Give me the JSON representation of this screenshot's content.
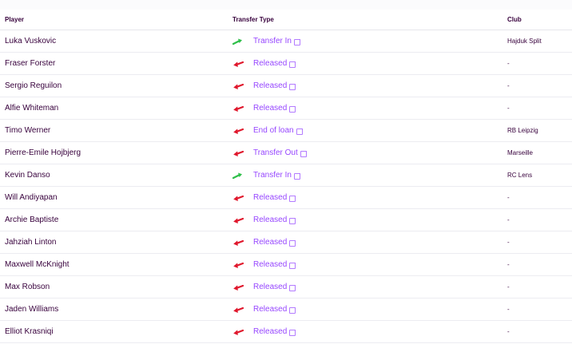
{
  "page": {
    "heading": ""
  },
  "table": {
    "headers": {
      "player": "Player",
      "transfer_type": "Transfer Type",
      "club": "Club"
    },
    "rows": [
      {
        "player": "Luka Vuskovic",
        "type": "Transfer In",
        "direction": "in",
        "club": "Hajduk Split"
      },
      {
        "player": "Fraser Forster",
        "type": "Released",
        "direction": "out",
        "club": "-"
      },
      {
        "player": "Sergio Reguilon",
        "type": "Released",
        "direction": "out",
        "club": "-"
      },
      {
        "player": "Alfie Whiteman",
        "type": "Released",
        "direction": "out",
        "club": "-"
      },
      {
        "player": "Timo Werner",
        "type": "End of loan",
        "direction": "out",
        "club": "RB Leipzig"
      },
      {
        "player": "Pierre-Emile Hojbjerg",
        "type": "Transfer Out",
        "direction": "out",
        "club": "Marseille"
      },
      {
        "player": "Kevin Danso",
        "type": "Transfer In",
        "direction": "in",
        "club": "RC Lens"
      },
      {
        "player": "Will Andiyapan",
        "type": "Released",
        "direction": "out",
        "club": "-"
      },
      {
        "player": "Archie Baptiste",
        "type": "Released",
        "direction": "out",
        "club": "-"
      },
      {
        "player": "Jahziah Linton",
        "type": "Released",
        "direction": "out",
        "club": "-"
      },
      {
        "player": "Maxwell McKnight",
        "type": "Released",
        "direction": "out",
        "club": "-"
      },
      {
        "player": "Max Robson",
        "type": "Released",
        "direction": "out",
        "club": "-"
      },
      {
        "player": "Jaden Williams",
        "type": "Released",
        "direction": "out",
        "club": "-"
      },
      {
        "player": "Elliot Krasniqi",
        "type": "Released",
        "direction": "out",
        "club": "-"
      }
    ]
  },
  "colors": {
    "in_arrow": "#2fbf4a",
    "out_arrow": "#e0182d",
    "link": "#9747ff",
    "text": "#37003c"
  },
  "icons": {
    "in": "arrow-in-icon",
    "out": "arrow-out-icon",
    "external": "external-link-icon"
  }
}
